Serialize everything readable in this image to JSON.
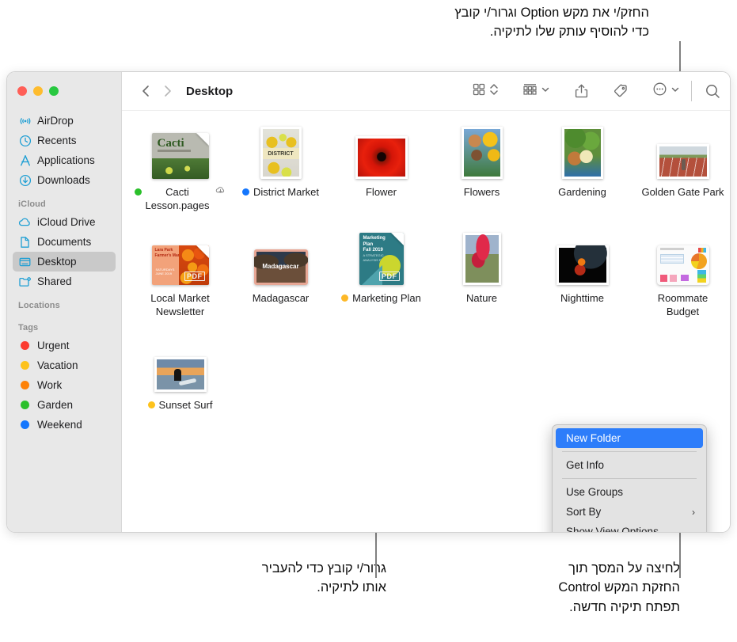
{
  "callouts": {
    "top": "החזק/י את מקש Option וגרור/י קובץ\nכדי להוסיף עותק שלו לתיקיה.",
    "bottom_left": "גרור/י קובץ כדי להעביר\nאותו לתיקיה.",
    "bottom_right": "לחיצה על המסך תוך\nהחזקת המקש Control\nתפתח תיקיה חדשה."
  },
  "window": {
    "title": "Desktop",
    "traffic_lights": [
      {
        "name": "close",
        "color": "#ff5f57"
      },
      {
        "name": "minimize",
        "color": "#febc2e"
      },
      {
        "name": "zoom",
        "color": "#28c840"
      }
    ]
  },
  "sidebar": {
    "favorites": [
      {
        "label": "AirDrop",
        "icon": "airdrop-icon",
        "selected": false
      },
      {
        "label": "Recents",
        "icon": "clock-icon",
        "selected": false
      },
      {
        "label": "Applications",
        "icon": "applications-icon",
        "selected": false
      },
      {
        "label": "Downloads",
        "icon": "download-icon",
        "selected": false
      }
    ],
    "icloud_header": "iCloud",
    "icloud": [
      {
        "label": "iCloud Drive",
        "icon": "cloud-icon",
        "selected": false
      },
      {
        "label": "Documents",
        "icon": "document-icon",
        "selected": false
      },
      {
        "label": "Desktop",
        "icon": "desktop-icon",
        "selected": true
      },
      {
        "label": "Shared",
        "icon": "shared-folder-icon",
        "selected": false
      }
    ],
    "locations_header": "Locations",
    "tags_header": "Tags",
    "tags": [
      {
        "label": "Urgent",
        "color": "#fc3b30"
      },
      {
        "label": "Vacation",
        "color": "#fdc21c"
      },
      {
        "label": "Work",
        "color": "#fd8208"
      },
      {
        "label": "Garden",
        "color": "#2bc02b"
      },
      {
        "label": "Weekend",
        "color": "#1476fd"
      }
    ]
  },
  "toolbar": {
    "back_label": "Back",
    "forward_label": "Forward",
    "view_label": "Icon View",
    "group_label": "Group By",
    "share_label": "Share",
    "tag_label": "Tags",
    "more_label": "More",
    "search_label": "Search"
  },
  "files": [
    [
      {
        "name": "Cacti\nLesson.pages",
        "tag": "#2bc02b",
        "cloud": true,
        "kind": "pages-doc"
      },
      {
        "name": "District Market",
        "tag": "#1476fd",
        "cloud": false,
        "kind": "photo-market"
      },
      {
        "name": "Flower",
        "tag": null,
        "cloud": false,
        "kind": "photo-flower"
      },
      {
        "name": "Flowers",
        "tag": null,
        "cloud": false,
        "kind": "photo-flowers"
      },
      {
        "name": "Gardening",
        "tag": null,
        "cloud": false,
        "kind": "photo-gardening"
      },
      {
        "name": "Golden Gate Park",
        "tag": null,
        "cloud": false,
        "kind": "photo-park"
      }
    ],
    [
      {
        "name": "Local Market\nNewsletter",
        "tag": null,
        "cloud": false,
        "kind": "pdf-newsletter"
      },
      {
        "name": "Madagascar",
        "tag": null,
        "cloud": false,
        "kind": "photo-madagascar"
      },
      {
        "name": "Marketing Plan",
        "tag": "#fdb827",
        "cloud": false,
        "kind": "pdf-marketing"
      },
      {
        "name": "Nature",
        "tag": null,
        "cloud": false,
        "kind": "photo-nature"
      },
      {
        "name": "Nighttime",
        "tag": null,
        "cloud": false,
        "kind": "photo-nighttime"
      },
      {
        "name": "Roommate\nBudget",
        "tag": null,
        "cloud": false,
        "kind": "numbers-doc"
      }
    ],
    [
      {
        "name": "Sunset Surf",
        "tag": "#fdc21c",
        "cloud": false,
        "kind": "photo-sunset"
      }
    ]
  ],
  "context_menu": {
    "items": [
      {
        "label": "New Folder",
        "highlight": true,
        "submenu": false,
        "sep_after": true
      },
      {
        "label": "Get Info",
        "highlight": false,
        "submenu": false,
        "sep_after": true
      },
      {
        "label": "Use Groups",
        "highlight": false,
        "submenu": false,
        "sep_after": false
      },
      {
        "label": "Sort By",
        "highlight": false,
        "submenu": true,
        "sep_after": false
      },
      {
        "label": "Show View Options",
        "highlight": false,
        "submenu": false,
        "sep_after": false
      }
    ],
    "submenu_arrow": "›"
  },
  "colors": {
    "highlight": "#2d7dfa",
    "sidebar_bg": "#e8e8e8",
    "sidebar_selected": "#c9c9c9",
    "menu_bg": "#e3e3e3",
    "sidebar_icon": "#1f9fd4"
  }
}
